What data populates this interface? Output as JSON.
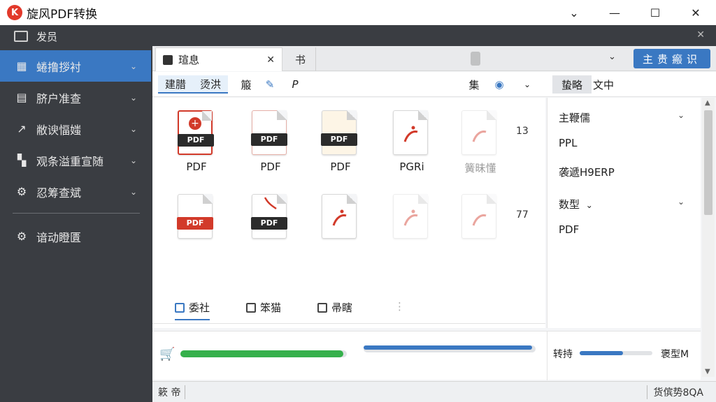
{
  "app": {
    "title": "旋风PDF转换",
    "logo_text": "K"
  },
  "window_controls": {
    "chevron": "⌄",
    "minimize": "—",
    "maximize": "☐",
    "close": "✕"
  },
  "sidebar": {
    "header_label": "发员",
    "items": [
      {
        "label": "蜷撸拶衬",
        "icon": "layout-icon"
      },
      {
        "label": "脐户准查",
        "icon": "document-icon"
      },
      {
        "label": "敝谀愊媸",
        "icon": "convert-icon"
      },
      {
        "label": "观条溢重宣随",
        "icon": "grid-icon"
      },
      {
        "label": "忍筹查斌",
        "icon": "gear-icon"
      }
    ],
    "settings_label": "谙动瞪匱"
  },
  "tabs": {
    "active_label": "瑄息",
    "second_label": "书",
    "primary_button": "主贵瘢识"
  },
  "toolbar": {
    "seg1": "建腊",
    "seg2": "烫洪",
    "tool1": "箙",
    "tool3": "P",
    "right1": "集",
    "pane_active": "蛰略",
    "pane_other": "文中"
  },
  "files": [
    {
      "label": "PDF"
    },
    {
      "label": "PDF"
    },
    {
      "label": "PDF"
    },
    {
      "label": "PGRi"
    },
    {
      "label": "簧昧懂"
    },
    {
      "label": ""
    },
    {
      "label": ""
    },
    {
      "label": ""
    },
    {
      "label": ""
    },
    {
      "label": ""
    }
  ],
  "side_numbers": [
    "13",
    "77"
  ],
  "bottom_tabs": [
    "委社",
    "笨猫",
    "帚瞎"
  ],
  "properties": {
    "section1": "主鞭儒",
    "value1": "PPL",
    "value2": "袭遞H9ERP",
    "section2": "数型",
    "value3": "PDF"
  },
  "progress": {
    "green_level": 0.98,
    "blue_level": 0.98,
    "right_label": "转持",
    "right_level": 0.6,
    "right_value": "褒型M"
  },
  "status": {
    "left": "簌 帝",
    "right": "货傧势8QA"
  },
  "colors": {
    "accent": "#3a78c2",
    "sidebar_bg": "#3a3d42",
    "brand": "#e2392b",
    "pdf_red": "#d23a2a",
    "green": "#2b9a3d"
  }
}
